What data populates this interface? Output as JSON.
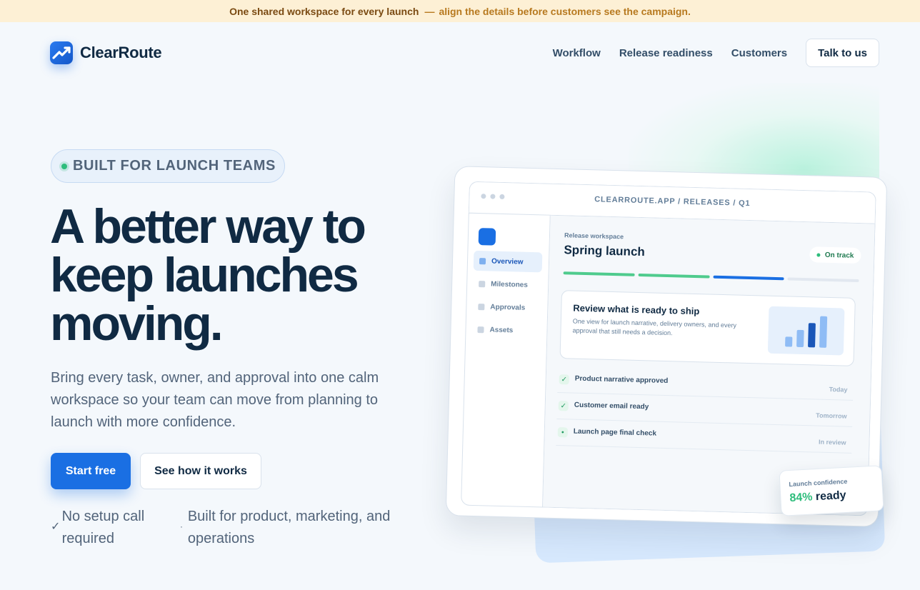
{
  "announcement": {
    "lead": "One shared workspace for every launch",
    "separator": "—",
    "tail": "align the details before customers see the campaign."
  },
  "nav": {
    "brand": "ClearRoute",
    "links": [
      "Workflow",
      "Release readiness",
      "Customers"
    ],
    "cta": "Talk to us"
  },
  "hero": {
    "badge": "BUILT FOR LAUNCH TEAMS",
    "headline": "A better way to keep launches moving.",
    "subcopy": "Bring every task, owner, and approval into one calm workspace so your team can move from planning to launch with more confidence.",
    "primary_cta": "Start free",
    "secondary_cta": "See how it works",
    "features": [
      {
        "mark": "✓",
        "text": "No setup call required"
      },
      {
        "mark": "·",
        "text": "Built for product, marketing, and operations"
      }
    ]
  },
  "mockup": {
    "url": "CLEARROUTE.APP / RELEASES / Q1",
    "sidebar": [
      "Overview",
      "Milestones",
      "Approvals",
      "Assets"
    ],
    "workspace_label": "Release workspace",
    "workspace_title": "Spring launch",
    "status": "On track",
    "progress_segments": [
      {
        "state": "done",
        "color": "#4fcb8d"
      },
      {
        "state": "done",
        "color": "#4fcb8d"
      },
      {
        "state": "active",
        "color": "#1a6fe3"
      },
      {
        "state": "pending",
        "color": "#e2e8f0"
      }
    ],
    "card": {
      "title": "Review what is ready to ship",
      "description": "One view for launch narrative, delivery owners, and every approval that still needs a decision."
    },
    "card_bars": [
      0.28,
      0.48,
      0.68,
      0.88
    ],
    "tasks": [
      {
        "mark": "✓",
        "name": "Product narrative approved",
        "when": "Today"
      },
      {
        "mark": "✓",
        "name": "Customer email ready",
        "when": "Tomorrow"
      },
      {
        "mark": "•",
        "name": "Launch page final check",
        "when": "In review"
      }
    ],
    "confidence": {
      "label": "Launch confidence",
      "value": "84%",
      "suffix": "ready"
    }
  },
  "colors": {
    "accent": "#1a6fe3",
    "success": "#2ebd7c",
    "heading": "#102a43",
    "body": "#52647a",
    "banner_bg": "#fdf0d5"
  },
  "icons": {
    "logo": "chart-trend-icon",
    "badge_dot": "status-dot-icon",
    "check": "check-icon"
  }
}
